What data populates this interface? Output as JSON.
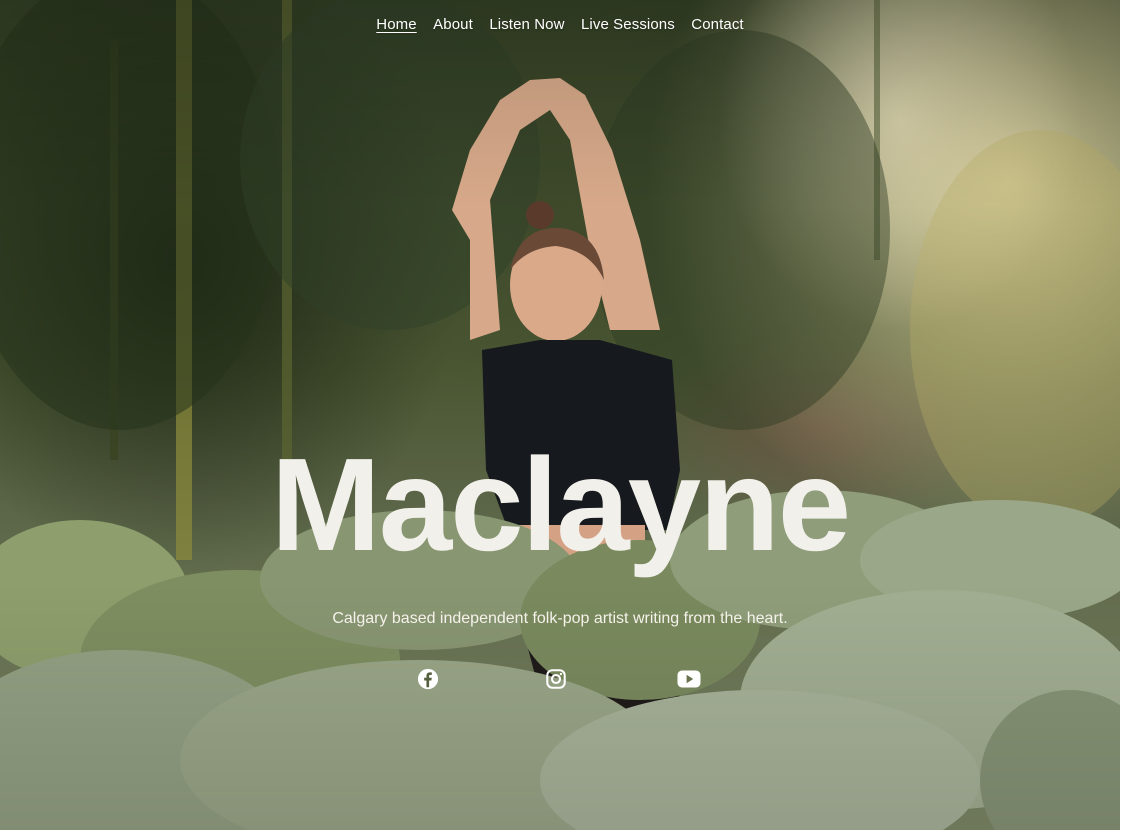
{
  "nav": {
    "items": [
      {
        "label": "Home",
        "active": true
      },
      {
        "label": "About",
        "active": false
      },
      {
        "label": "Listen Now",
        "active": false
      },
      {
        "label": "Live Sessions",
        "active": false
      },
      {
        "label": "Contact",
        "active": false
      }
    ]
  },
  "hero": {
    "title": "Maclayne",
    "tagline": "Calgary based independent folk-pop artist writing from the heart."
  },
  "social": {
    "icons": [
      "facebook-icon",
      "instagram-icon",
      "youtube-icon"
    ]
  },
  "colors": {
    "text": "#ffffff",
    "title": "#f1f0ea"
  }
}
